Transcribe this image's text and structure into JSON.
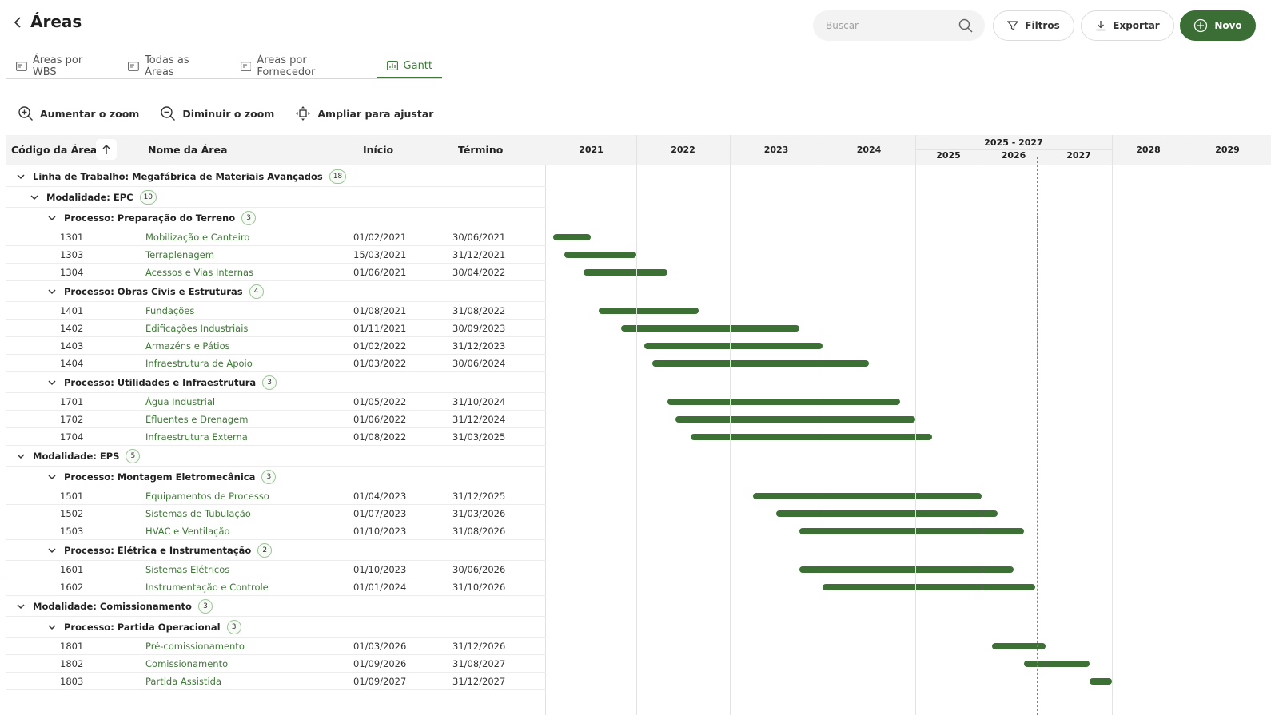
{
  "header": {
    "title": "Áreas",
    "search_placeholder": "Buscar",
    "filters_label": "Filtros",
    "export_label": "Exportar",
    "new_label": "Novo"
  },
  "tabs": [
    {
      "label": "Áreas por WBS"
    },
    {
      "label": "Todas as Áreas"
    },
    {
      "label": "Áreas por Fornecedor"
    },
    {
      "label": "Gantt"
    }
  ],
  "tools": {
    "zoom_in": "Aumentar o zoom",
    "zoom_out": "Diminuir o zoom",
    "fit": "Ampliar para ajustar"
  },
  "grid": {
    "col_code": "Código da Área",
    "col_name": "Nome da Área",
    "col_start": "Início",
    "col_end": "Término"
  },
  "timeline": {
    "group_label": "2025 - 2027",
    "years": [
      "2021",
      "2022",
      "2023",
      "2024",
      "2025",
      "2026",
      "2027",
      "2028",
      "2029"
    ]
  },
  "rows": [
    {
      "kind": "group",
      "level": 0,
      "label": "Linha de Trabalho: Megafábrica de Materiais Avançados",
      "count": "18"
    },
    {
      "kind": "group",
      "level": 1,
      "label": "Modalidade: EPC",
      "count": "10"
    },
    {
      "kind": "group",
      "level": 2,
      "label": "Processo: Preparação do Terreno",
      "count": "3"
    },
    {
      "kind": "task",
      "code": "1301",
      "name": "Mobilização e Canteiro",
      "start": "01/02/2021",
      "end": "30/06/2021"
    },
    {
      "kind": "task",
      "code": "1303",
      "name": "Terraplenagem",
      "start": "15/03/2021",
      "end": "31/12/2021"
    },
    {
      "kind": "task",
      "code": "1304",
      "name": "Acessos e Vias Internas",
      "start": "01/06/2021",
      "end": "30/04/2022"
    },
    {
      "kind": "group",
      "level": 2,
      "label": "Processo: Obras Civis e Estruturas",
      "count": "4"
    },
    {
      "kind": "task",
      "code": "1401",
      "name": "Fundações",
      "start": "01/08/2021",
      "end": "31/08/2022"
    },
    {
      "kind": "task",
      "code": "1402",
      "name": "Edificações Industriais",
      "start": "01/11/2021",
      "end": "30/09/2023"
    },
    {
      "kind": "task",
      "code": "1403",
      "name": "Armazéns e Pátios",
      "start": "01/02/2022",
      "end": "31/12/2023"
    },
    {
      "kind": "task",
      "code": "1404",
      "name": "Infraestrutura de Apoio",
      "start": "01/03/2022",
      "end": "30/06/2024"
    },
    {
      "kind": "group",
      "level": 2,
      "label": "Processo: Utilidades e Infraestrutura",
      "count": "3"
    },
    {
      "kind": "task",
      "code": "1701",
      "name": "Água Industrial",
      "start": "01/05/2022",
      "end": "31/10/2024"
    },
    {
      "kind": "task",
      "code": "1702",
      "name": "Efluentes e Drenagem",
      "start": "01/06/2022",
      "end": "31/12/2024"
    },
    {
      "kind": "task",
      "code": "1704",
      "name": "Infraestrutura Externa",
      "start": "01/08/2022",
      "end": "31/03/2025"
    },
    {
      "kind": "group",
      "level": 0,
      "label": "Modalidade: EPS",
      "count": "5"
    },
    {
      "kind": "group",
      "level": 2,
      "label": "Processo: Montagem Eletromecânica",
      "count": "3"
    },
    {
      "kind": "task",
      "code": "1501",
      "name": "Equipamentos de Processo",
      "start": "01/04/2023",
      "end": "31/12/2025"
    },
    {
      "kind": "task",
      "code": "1502",
      "name": "Sistemas de Tubulação",
      "start": "01/07/2023",
      "end": "31/03/2026"
    },
    {
      "kind": "task",
      "code": "1503",
      "name": "HVAC e Ventilação",
      "start": "01/10/2023",
      "end": "31/08/2026"
    },
    {
      "kind": "group",
      "level": 2,
      "label": "Processo: Elétrica e Instrumentação",
      "count": "2"
    },
    {
      "kind": "task",
      "code": "1601",
      "name": "Sistemas Elétricos",
      "start": "01/10/2023",
      "end": "30/06/2026"
    },
    {
      "kind": "task",
      "code": "1602",
      "name": "Instrumentação e Controle",
      "start": "01/01/2024",
      "end": "31/10/2026"
    },
    {
      "kind": "group",
      "level": 0,
      "label": "Modalidade: Comissionamento",
      "count": "3"
    },
    {
      "kind": "group",
      "level": 2,
      "label": "Processo: Partida Operacional",
      "count": "3"
    },
    {
      "kind": "task",
      "code": "1801",
      "name": "Pré-comissionamento",
      "start": "01/03/2026",
      "end": "31/12/2026"
    },
    {
      "kind": "task",
      "code": "1802",
      "name": "Comissionamento",
      "start": "01/09/2026",
      "end": "31/08/2027"
    },
    {
      "kind": "task",
      "code": "1803",
      "name": "Partida Assistida",
      "start": "01/09/2027",
      "end": "31/12/2027"
    }
  ],
  "colors": {
    "accent": "#3d7a35",
    "bar": "#3c7035",
    "header_bg": "#f3f3f3"
  }
}
